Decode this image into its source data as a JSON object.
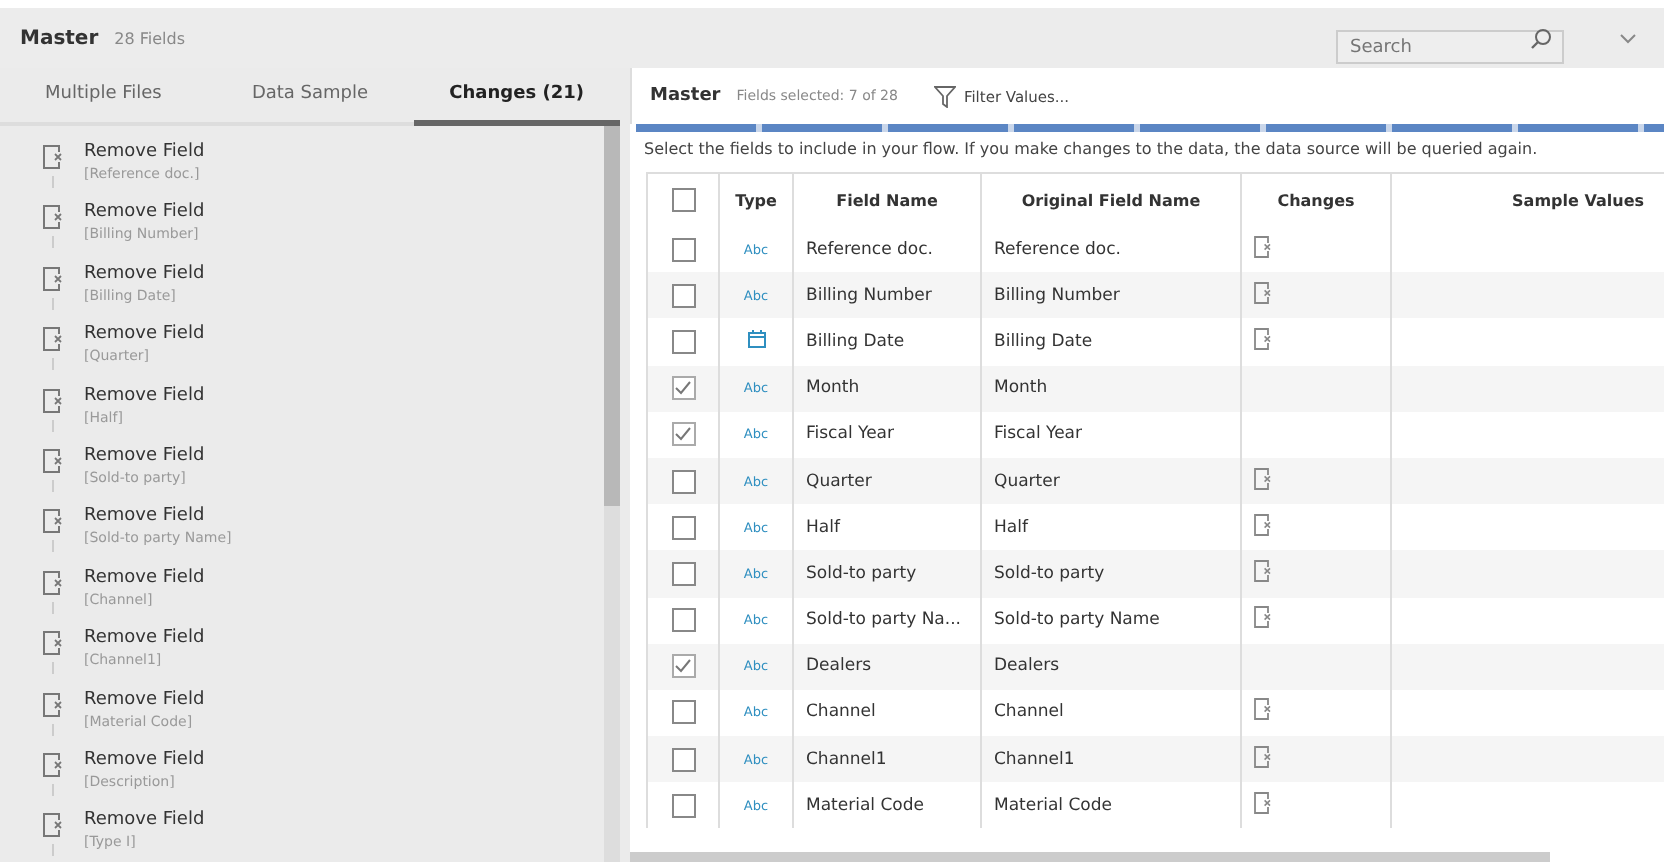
{
  "header": {
    "title": "Master",
    "subtitle": "28 Fields",
    "search": {
      "placeholder": "Search"
    }
  },
  "tabs": [
    {
      "label": "Multiple Files",
      "selected": false
    },
    {
      "label": "Data Sample",
      "selected": false
    },
    {
      "label": "Changes (21)",
      "selected": true
    }
  ],
  "changes": [
    {
      "action": "Remove Field",
      "field": "[Reference doc.]"
    },
    {
      "action": "Remove Field",
      "field": "[Billing Number]"
    },
    {
      "action": "Remove Field",
      "field": "[Billing Date]"
    },
    {
      "action": "Remove Field",
      "field": "[Quarter]"
    },
    {
      "action": "Remove Field",
      "field": "[Half]"
    },
    {
      "action": "Remove Field",
      "field": "[Sold-to party]"
    },
    {
      "action": "Remove Field",
      "field": "[Sold-to party Name]"
    },
    {
      "action": "Remove Field",
      "field": "[Channel]"
    },
    {
      "action": "Remove Field",
      "field": "[Channel1]"
    },
    {
      "action": "Remove Field",
      "field": "[Material Code]"
    },
    {
      "action": "Remove Field",
      "field": "[Description]"
    },
    {
      "action": "Remove Field",
      "field": "[Type I]"
    }
  ],
  "panel": {
    "title": "Master",
    "selected_count": "Fields selected: 7 of 28",
    "filter": "Filter Values...",
    "hint": "Select the fields to include in your flow. If you make changes to the data, the data source will be queried again."
  },
  "table": {
    "all_checked": false,
    "columns": [
      "Type",
      "Field Name",
      "Original Field Name",
      "Changes",
      "Sample Values"
    ],
    "rows": [
      {
        "checked": false,
        "kind": "string",
        "type_label": "Abc",
        "name": "Reference doc.",
        "original": "Reference doc.",
        "removed": true
      },
      {
        "checked": false,
        "kind": "string",
        "type_label": "Abc",
        "name": "Billing Number",
        "original": "Billing Number",
        "removed": true
      },
      {
        "checked": false,
        "kind": "date",
        "name": "Billing Date",
        "original": "Billing Date",
        "removed": true
      },
      {
        "checked": true,
        "kind": "string",
        "type_label": "Abc",
        "name": "Month",
        "original": "Month",
        "removed": false
      },
      {
        "checked": true,
        "kind": "string",
        "type_label": "Abc",
        "name": "Fiscal Year",
        "original": "Fiscal Year",
        "removed": false
      },
      {
        "checked": false,
        "kind": "string",
        "type_label": "Abc",
        "name": "Quarter",
        "original": "Quarter",
        "removed": true
      },
      {
        "checked": false,
        "kind": "string",
        "type_label": "Abc",
        "name": "Half",
        "original": "Half",
        "removed": true
      },
      {
        "checked": false,
        "kind": "string",
        "type_label": "Abc",
        "name": "Sold-to party",
        "original": "Sold-to party",
        "removed": true
      },
      {
        "checked": false,
        "kind": "string",
        "type_label": "Abc",
        "name": "Sold-to party Na...",
        "original": "Sold-to party Name",
        "removed": true
      },
      {
        "checked": true,
        "kind": "string",
        "type_label": "Abc",
        "name": "Dealers",
        "original": "Dealers",
        "removed": false
      },
      {
        "checked": false,
        "kind": "string",
        "type_label": "Abc",
        "name": "Channel",
        "original": "Channel",
        "removed": true
      },
      {
        "checked": false,
        "kind": "string",
        "type_label": "Abc",
        "name": "Channel1",
        "original": "Channel1",
        "removed": true
      },
      {
        "checked": false,
        "kind": "string",
        "type_label": "Abc",
        "name": "Material Code",
        "original": "Material Code",
        "removed": true
      }
    ]
  }
}
